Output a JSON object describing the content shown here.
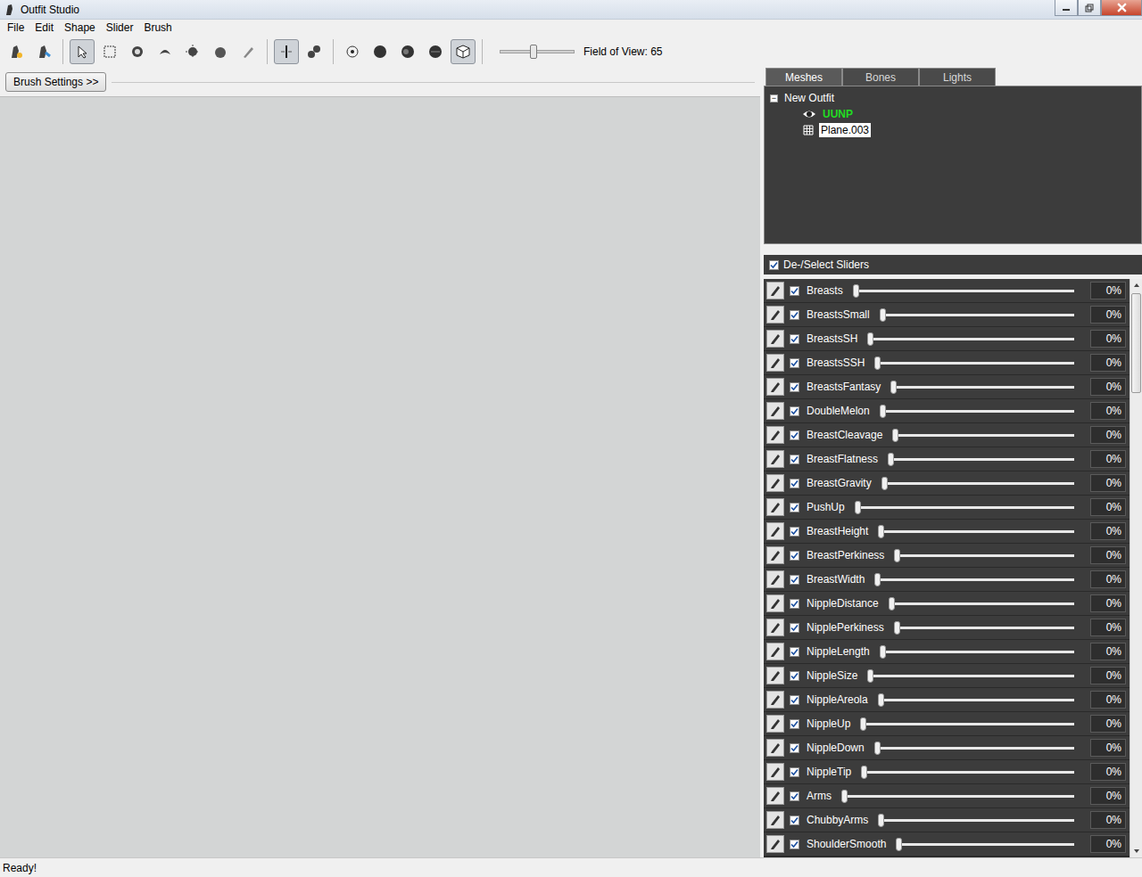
{
  "window": {
    "title": "Outfit Studio"
  },
  "menu": [
    "File",
    "Edit",
    "Shape",
    "Slider",
    "Brush"
  ],
  "toolbar": {
    "groups": [
      {
        "tools": [
          {
            "selected": false
          },
          {
            "selected": false
          }
        ]
      },
      {
        "tools": [
          {
            "selected": true
          },
          {
            "selected": false
          },
          {
            "selected": false
          },
          {
            "selected": false
          },
          {
            "selected": false
          },
          {
            "selected": false
          },
          {
            "selected": false
          }
        ]
      },
      {
        "tools": [
          {
            "selected": true
          },
          {
            "selected": false
          }
        ]
      },
      {
        "tools": [
          {
            "selected": false
          },
          {
            "selected": false
          },
          {
            "selected": false
          },
          {
            "selected": false
          },
          {
            "selected": true
          }
        ]
      }
    ],
    "fov": {
      "level": 0.45,
      "label": "Field of View: 65"
    }
  },
  "brush_settings": {
    "label": "Brush Settings >>"
  },
  "tabs": [
    {
      "label": "Meshes",
      "selected": true
    },
    {
      "label": "Bones",
      "selected": false
    },
    {
      "label": "Lights",
      "selected": false
    }
  ],
  "tree": {
    "root": {
      "label": "New Outfit",
      "expanded": true,
      "collapse_glyph": "−"
    },
    "children": [
      {
        "label": "UUNP",
        "kind": "reference",
        "visible": true,
        "selected": false,
        "color": "#22dd22"
      },
      {
        "label": "Plane.003",
        "kind": "mesh",
        "visible": false,
        "selected": true,
        "color": "#ffffff"
      }
    ]
  },
  "sliders_header": {
    "label": "De-/Select Sliders",
    "checked": true
  },
  "sliders": [
    {
      "name": "Breasts",
      "checked": true,
      "level": 0,
      "reading": "0%"
    },
    {
      "name": "BreastsSmall",
      "checked": true,
      "level": 0,
      "reading": "0%"
    },
    {
      "name": "BreastsSH",
      "checked": true,
      "level": 0,
      "reading": "0%"
    },
    {
      "name": "BreastsSSH",
      "checked": true,
      "level": 0,
      "reading": "0%"
    },
    {
      "name": "BreastsFantasy",
      "checked": true,
      "level": 0,
      "reading": "0%"
    },
    {
      "name": "DoubleMelon",
      "checked": true,
      "level": 0,
      "reading": "0%"
    },
    {
      "name": "BreastCleavage",
      "checked": true,
      "level": 0,
      "reading": "0%"
    },
    {
      "name": "BreastFlatness",
      "checked": true,
      "level": 0,
      "reading": "0%"
    },
    {
      "name": "BreastGravity",
      "checked": true,
      "level": 0,
      "reading": "0%"
    },
    {
      "name": "PushUp",
      "checked": true,
      "level": 0,
      "reading": "0%"
    },
    {
      "name": "BreastHeight",
      "checked": true,
      "level": 0,
      "reading": "0%"
    },
    {
      "name": "BreastPerkiness",
      "checked": true,
      "level": 0,
      "reading": "0%"
    },
    {
      "name": "BreastWidth",
      "checked": true,
      "level": 0,
      "reading": "0%"
    },
    {
      "name": "NippleDistance",
      "checked": true,
      "level": 0,
      "reading": "0%"
    },
    {
      "name": "NipplePerkiness",
      "checked": true,
      "level": 0,
      "reading": "0%"
    },
    {
      "name": "NippleLength",
      "checked": true,
      "level": 0,
      "reading": "0%"
    },
    {
      "name": "NippleSize",
      "checked": true,
      "level": 0,
      "reading": "0%"
    },
    {
      "name": "NippleAreola",
      "checked": true,
      "level": 0,
      "reading": "0%"
    },
    {
      "name": "NippleUp",
      "checked": true,
      "level": 0,
      "reading": "0%"
    },
    {
      "name": "NippleDown",
      "checked": true,
      "level": 0,
      "reading": "0%"
    },
    {
      "name": "NippleTip",
      "checked": true,
      "level": 0,
      "reading": "0%"
    },
    {
      "name": "Arms",
      "checked": true,
      "level": 0,
      "reading": "0%"
    },
    {
      "name": "ChubbyArms",
      "checked": true,
      "level": 0,
      "reading": "0%"
    },
    {
      "name": "ShoulderSmooth",
      "checked": true,
      "level": 0,
      "reading": "0%"
    }
  ],
  "status_bar": {
    "text": "Ready!"
  }
}
